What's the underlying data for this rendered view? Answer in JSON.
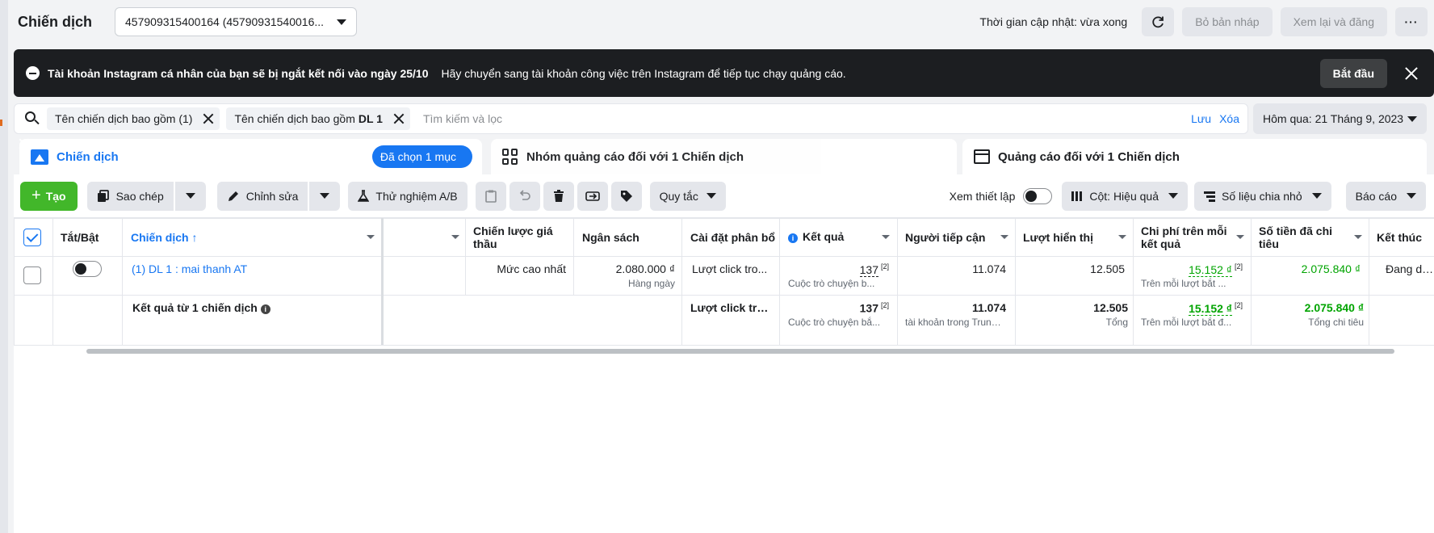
{
  "topbar": {
    "title": "Chiến dịch",
    "account": "457909315400164 (45790931540016...",
    "update_status": "Thời gian cập nhật: vừa xong",
    "discard_draft": "Bỏ bản nháp",
    "review_publish": "Xem lại và đăng",
    "more": "···"
  },
  "banner": {
    "title": "Tài khoản Instagram cá nhân của bạn sẽ bị ngắt kết nối vào ngày 25/10",
    "message": "Hãy chuyển sang tài khoản công việc trên Instagram để tiếp tục chạy quảng cáo.",
    "start": "Bắt đầu"
  },
  "search": {
    "chip1": "Tên chiến dịch bao gồm (1)",
    "chip2_prefix": "Tên chiến dịch bao gồm",
    "chip2_value": "DL 1",
    "placeholder": "Tìm kiếm và lọc",
    "save": "Lưu",
    "clear": "Xóa",
    "date": "Hôm qua: 21 Tháng 9, 2023"
  },
  "tabs": {
    "campaigns": "Chiến dịch",
    "selected": "Đã chọn 1 mục",
    "adsets": "Nhóm quảng cáo đối với 1 Chiến dịch",
    "ads": "Quảng cáo đối với 1 Chiến dịch"
  },
  "toolbar": {
    "create": "Tạo",
    "copy": "Sao chép",
    "edit": "Chỉnh sửa",
    "ab_test": "Thử nghiệm A/B",
    "rules": "Quy tắc",
    "view_setup": "Xem thiết lập",
    "columns": "Cột: Hiệu quả",
    "breakdown": "Số liệu chia nhỏ",
    "reports": "Báo cáo"
  },
  "table": {
    "headers": {
      "onoff": "Tắt/Bật",
      "campaign": "Chiến dịch ↑",
      "bid_strategy": "Chiến lược giá thầu",
      "budget": "Ngân sách",
      "attribution": "Cài đặt phân bổ",
      "results": "Kết quả",
      "reach": "Người tiếp cận",
      "impressions": "Lượt hiển thị",
      "cost_per_result": "Chi phí trên mỗi kết quả",
      "amount_spent": "Số tiền đã chi tiêu",
      "ends": "Kết thúc"
    },
    "row": {
      "name": "(1) DL 1 : mai thanh AT",
      "bid_strategy": "Mức cao nhất",
      "budget": "2.080.000 ₫",
      "budget_sub": "Hàng ngày",
      "attribution": "Lượt click tro...",
      "results": "137",
      "results_note": "[2]",
      "results_sub": "Cuộc trò chuyện b...",
      "reach": "11.074",
      "impressions": "12.505",
      "cpr": "15.152 ₫",
      "cpr_note": "[2]",
      "cpr_sub": "Trên mỗi lượt bắt ...",
      "spent": "2.075.840 ₫",
      "ends": "Đang diễn"
    },
    "summary": {
      "label": "Kết quả từ 1 chiến dịch",
      "attribution": "Lượt click tro...",
      "results": "137",
      "results_note": "[2]",
      "results_sub": "Cuộc trò chuyện bắ...",
      "reach": "11.074",
      "reach_sub": "tài khoản trong Trung t...",
      "impressions": "12.505",
      "impressions_sub": "Tổng",
      "cpr": "15.152 ₫",
      "cpr_note": "[2]",
      "cpr_sub": "Trên mỗi lượt bắt đ...",
      "spent": "2.075.840 ₫",
      "spent_sub": "Tổng chi tiêu"
    }
  },
  "colors": {
    "accent": "#1877f2",
    "create": "#42b72a",
    "money": "#00a400",
    "banner_bg": "#1c1e21"
  }
}
